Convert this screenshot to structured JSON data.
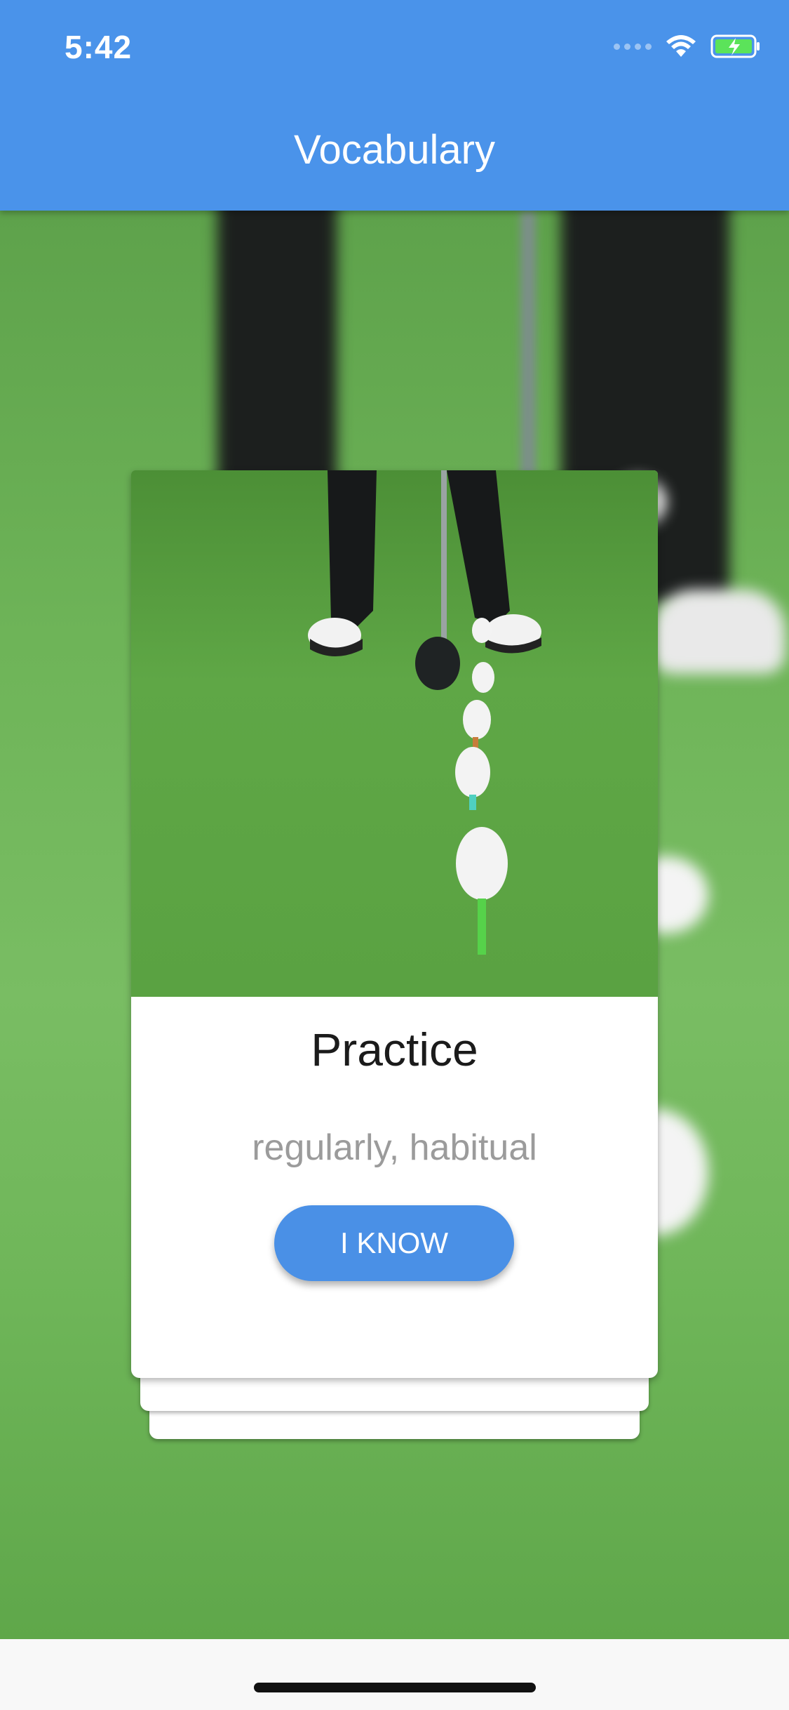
{
  "status_bar": {
    "time": "5:42",
    "icons": [
      "signal-dots-icon",
      "wifi-icon",
      "battery-charging-icon"
    ]
  },
  "header": {
    "title": "Vocabulary",
    "background_color": "#4a93ea"
  },
  "card": {
    "word": "Practice",
    "meaning": "regularly, habitual",
    "know_button_label": "I KNOW",
    "accent_color": "#4a90e6"
  }
}
